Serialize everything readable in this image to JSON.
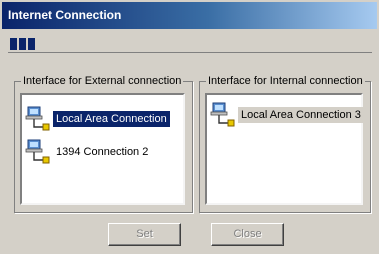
{
  "window": {
    "title": "Internet Connection"
  },
  "progress": {
    "filled_segments": 3
  },
  "external": {
    "legend": "Interface for External connection",
    "items": [
      {
        "label": "Local Area Connection",
        "icon": "network-connection-icon",
        "selected": true
      },
      {
        "label": "1394 Connection 2",
        "icon": "network-connection-icon",
        "selected": false
      }
    ]
  },
  "internal": {
    "legend": "Interface for Internal connection",
    "items": [
      {
        "label": "Local Area Connection 3",
        "icon": "network-connection-icon",
        "selected": true
      }
    ]
  },
  "buttons": {
    "set_label": "Set",
    "close_label": "Close"
  },
  "colors": {
    "title_bar": "#0a246a",
    "selection": "#0a246a",
    "face": "#d4d0c8"
  }
}
